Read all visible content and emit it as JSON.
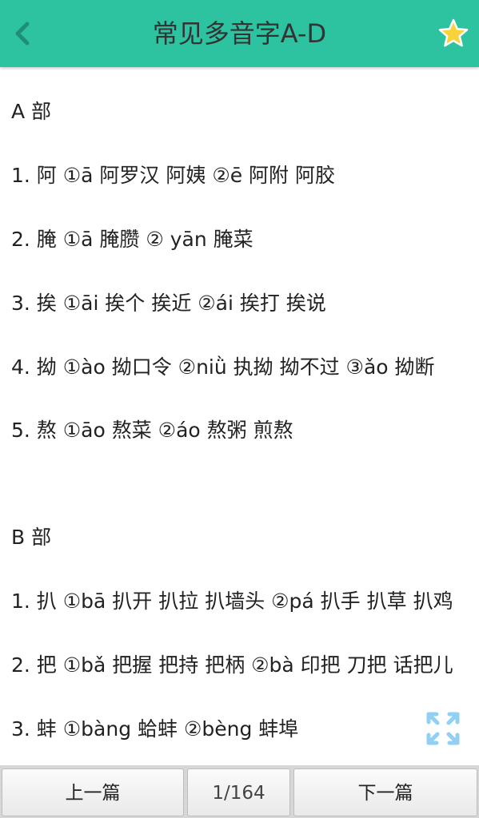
{
  "header": {
    "title": "常见多音字A-D",
    "back_icon": "chevron-left-icon",
    "favorite_icon": "star-icon",
    "bg_color": "#2dc2a0",
    "star_color": "#f7d23a"
  },
  "content": {
    "lines": [
      "A 部",
      "1. 阿 ①ā 阿罗汉 阿姨 ②ē 阿附 阿胶",
      "2. 腌 ①ā 腌臜 ② yān 腌菜",
      "3. 挨 ①āi 挨个 挨近 ②ái 挨打 挨说",
      "4. 拗 ①ào 拗口令 ②niǜ 执拗 拗不过 ③ǎo 拗断",
      "5. 熬 ①āo 熬菜 ②áo 熬粥 煎熬",
      "B 部",
      "1. 扒 ①bā 扒开 扒拉 扒墙头 ②pá 扒手 扒草 扒鸡",
      "2. 把 ①bǎ 把握 把持 把柄 ②bà 印把 刀把 话把儿",
      "3. 蚌 ①bàng 蛤蚌 ②bèng 蚌埠"
    ],
    "fullscreen_icon": "expand-icon"
  },
  "footer": {
    "prev_label": "上一篇",
    "page_indicator": "1/164",
    "next_label": "下一篇"
  }
}
